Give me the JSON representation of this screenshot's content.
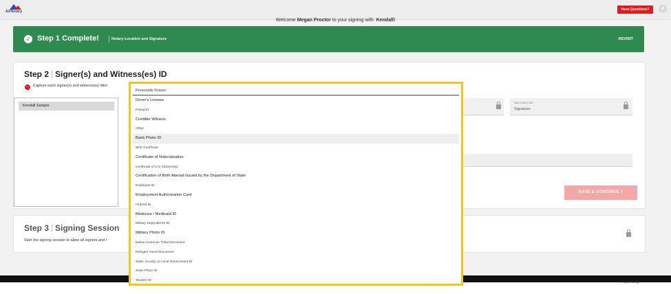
{
  "header": {
    "logo_text": "AXNotary",
    "questions_label": "Have Questions?",
    "avatar_initial": "A",
    "welcome_prefix": "Welcome",
    "welcome_name": "Megan Proctor",
    "welcome_mid": "to your signing with:",
    "welcome_with": "Kendall!"
  },
  "step1": {
    "title": "Step 1 Complete!",
    "subtitle": "Notary Location and Signature",
    "revisit_label": "REVISIT"
  },
  "step2": {
    "title_num": "Step 2",
    "title_text": "Signer(s) and Witness(es) ID",
    "hint": "Capture each signer(s) and witness(es) iden",
    "signers": [
      "Kendall Sample"
    ],
    "field_label": "SECTION FOR",
    "field_value": "Signature",
    "save_label": "SAVE & CONTINUE >"
  },
  "step3": {
    "title_num": "Step 3",
    "title_text": "Signing Session",
    "desc": "Start the signing session to allow all signers and r"
  },
  "footer": {
    "powered": "Powered By"
  },
  "id_dropdown": {
    "selected": "Personally Known",
    "options": [
      "Driver's License",
      "Passport",
      "Credible Witness",
      "Other",
      "Bank Photo ID",
      "Birth Certificate",
      "Certificate of Naturalization",
      "Certificate of U.S Citizenship",
      "Certification of Birth Abroad Issued by the Department of State",
      "Employee ID",
      "Employment Authorization Card",
      "Federal ID",
      "Medicare / Medicaid ID",
      "Military Dependent's ID",
      "Military Photo ID",
      "Native American Tribal Document",
      "Refugee Travel Document",
      "State, County, or Local Government ID",
      "State Photo ID",
      "Student ID"
    ],
    "highlighted_index": 4
  }
}
